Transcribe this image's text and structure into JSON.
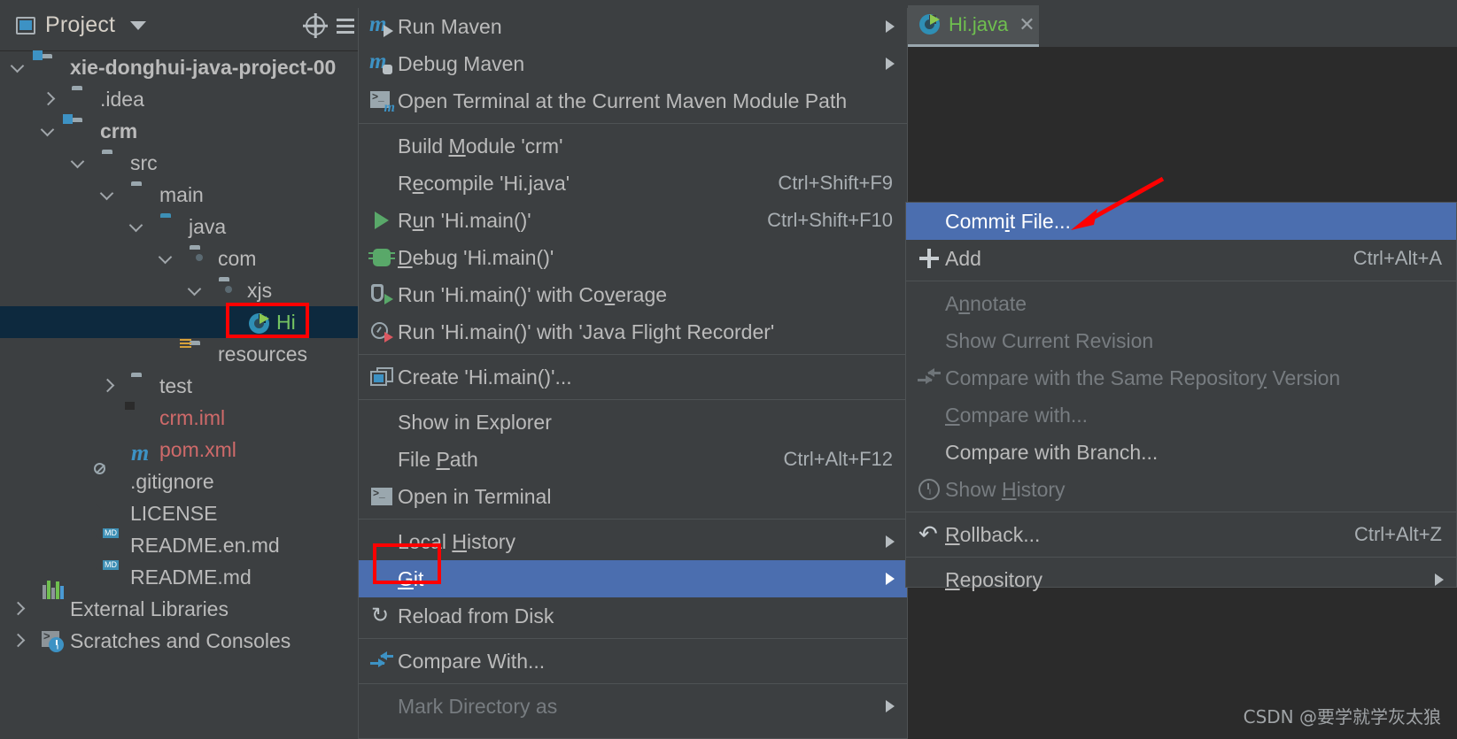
{
  "colors": {
    "panel_bg": "#3c3f41",
    "editor_bg": "#2b2b2b",
    "menu_highlight": "#4b6eaf",
    "tree_selection": "#0d293e",
    "annotation_red": "#ff0000",
    "accent_blue": "#3d92c4",
    "run_green": "#59a869"
  },
  "project_panel": {
    "title": "Project",
    "title_icon": "project-window-icon",
    "dropdown_icon": "chevron-down-icon",
    "toolbar_icons": [
      "locate-icon",
      "collapse-all-icon"
    ],
    "tree": [
      {
        "label": "xie-donghui-java-project-00",
        "indent": 14,
        "arrow": "open",
        "icon": "module-folder-icon",
        "style": "bold"
      },
      {
        "label": ".idea",
        "indent": 48,
        "arrow": "closed",
        "icon": "folder-icon",
        "style": "plain"
      },
      {
        "label": "crm",
        "indent": 48,
        "arrow": "open",
        "icon": "module-folder-icon",
        "style": "bold"
      },
      {
        "label": "src",
        "indent": 82,
        "arrow": "open",
        "icon": "folder-icon",
        "style": "plain"
      },
      {
        "label": "main",
        "indent": 115,
        "arrow": "open",
        "icon": "folder-icon",
        "style": "plain"
      },
      {
        "label": "java",
        "indent": 148,
        "arrow": "open",
        "icon": "source-folder-icon",
        "style": "plain"
      },
      {
        "label": "com",
        "indent": 181,
        "arrow": "open",
        "icon": "package-folder-icon",
        "style": "plain"
      },
      {
        "label": "xjs",
        "indent": 214,
        "arrow": "open",
        "icon": "package-folder-icon",
        "style": "plain"
      },
      {
        "label": "Hi",
        "indent": 247,
        "arrow": "none",
        "icon": "java-class-run-icon",
        "style": "green",
        "selected": true
      },
      {
        "label": "resources",
        "indent": 181,
        "arrow": "none",
        "icon": "resources-folder-icon",
        "style": "plain"
      },
      {
        "label": "test",
        "indent": 115,
        "arrow": "closed",
        "icon": "folder-icon",
        "style": "plain"
      },
      {
        "label": "crm.iml",
        "indent": 115,
        "arrow": "none",
        "icon": "iml-file-icon",
        "style": "red"
      },
      {
        "label": "pom.xml",
        "indent": 115,
        "arrow": "none",
        "icon": "maven-pom-icon",
        "style": "red"
      },
      {
        "label": ".gitignore",
        "indent": 82,
        "arrow": "none",
        "icon": "gitignore-file-icon",
        "style": "plain"
      },
      {
        "label": "LICENSE",
        "indent": 82,
        "arrow": "none",
        "icon": "text-file-icon",
        "style": "plain"
      },
      {
        "label": "README.en.md",
        "indent": 82,
        "arrow": "none",
        "icon": "markdown-file-icon",
        "style": "plain"
      },
      {
        "label": "README.md",
        "indent": 82,
        "arrow": "none",
        "icon": "markdown-file-icon",
        "style": "plain"
      },
      {
        "label": "External Libraries",
        "indent": 14,
        "arrow": "closed",
        "icon": "libraries-icon",
        "style": "plain"
      },
      {
        "label": "Scratches and Consoles",
        "indent": 14,
        "arrow": "closed",
        "icon": "scratches-icon",
        "style": "plain"
      }
    ]
  },
  "context_menu": {
    "items": [
      {
        "label": "Run Maven",
        "icon": "maven-run-icon",
        "shortcut": "",
        "submenu": true,
        "mnemonic": ""
      },
      {
        "label": "Debug Maven",
        "icon": "maven-debug-icon",
        "shortcut": "",
        "submenu": true,
        "mnemonic": ""
      },
      {
        "label": "Open Terminal at the Current Maven Module Path",
        "icon": "terminal-maven-icon",
        "shortcut": "",
        "submenu": false,
        "mnemonic": ""
      },
      {
        "separator": true
      },
      {
        "label": "Build Module 'crm'",
        "icon": "",
        "shortcut": "",
        "submenu": false,
        "mnemonic": "M"
      },
      {
        "label": "Recompile 'Hi.java'",
        "icon": "",
        "shortcut": "Ctrl+Shift+F9",
        "submenu": false,
        "mnemonic": "e"
      },
      {
        "label": "Run 'Hi.main()'",
        "icon": "run-icon",
        "shortcut": "Ctrl+Shift+F10",
        "submenu": false,
        "mnemonic": "u"
      },
      {
        "label": "Debug 'Hi.main()'",
        "icon": "debug-icon",
        "shortcut": "",
        "submenu": false,
        "mnemonic": "D"
      },
      {
        "label": "Run 'Hi.main()' with Coverage",
        "icon": "coverage-icon",
        "shortcut": "",
        "submenu": false,
        "mnemonic": "v"
      },
      {
        "label": "Run 'Hi.main()' with 'Java Flight Recorder'",
        "icon": "flight-recorder-icon",
        "shortcut": "",
        "submenu": false,
        "mnemonic": ""
      },
      {
        "separator": true
      },
      {
        "label": "Create 'Hi.main()'...",
        "icon": "create-config-icon",
        "shortcut": "",
        "submenu": false,
        "mnemonic": ""
      },
      {
        "separator": true
      },
      {
        "label": "Show in Explorer",
        "icon": "",
        "shortcut": "",
        "submenu": false,
        "mnemonic": ""
      },
      {
        "label": "File Path",
        "icon": "",
        "shortcut": "Ctrl+Alt+F12",
        "submenu": false,
        "mnemonic": "P"
      },
      {
        "label": "Open in Terminal",
        "icon": "terminal-icon",
        "shortcut": "",
        "submenu": false,
        "mnemonic": ""
      },
      {
        "separator": true
      },
      {
        "label": "Local History",
        "icon": "",
        "shortcut": "",
        "submenu": true,
        "mnemonic": "H"
      },
      {
        "label": "Git",
        "icon": "",
        "shortcut": "",
        "submenu": true,
        "mnemonic": "G",
        "highlighted": true
      },
      {
        "label": "Reload from Disk",
        "icon": "reload-icon",
        "shortcut": "",
        "submenu": false,
        "mnemonic": ""
      },
      {
        "separator": true
      },
      {
        "label": "Compare With...",
        "icon": "compare-icon",
        "shortcut": "",
        "submenu": false,
        "mnemonic": ""
      },
      {
        "separator": true
      },
      {
        "label": "Mark Directory as",
        "icon": "",
        "shortcut": "",
        "submenu": true,
        "mnemonic": "",
        "disabled": true
      }
    ]
  },
  "git_submenu": {
    "items": [
      {
        "label": "Commit File...",
        "icon": "",
        "shortcut": "",
        "submenu": false,
        "mnemonic": "i",
        "highlighted": true
      },
      {
        "label": "Add",
        "icon": "add-icon",
        "shortcut": "Ctrl+Alt+A",
        "submenu": false,
        "mnemonic": ""
      },
      {
        "separator": true
      },
      {
        "label": "Annotate",
        "icon": "",
        "shortcut": "",
        "submenu": false,
        "mnemonic": "n",
        "disabled": true
      },
      {
        "label": "Show Current Revision",
        "icon": "",
        "shortcut": "",
        "submenu": false,
        "mnemonic": "",
        "disabled": true
      },
      {
        "label": "Compare with the Same Repository Version",
        "icon": "compare-icon-gray",
        "shortcut": "",
        "submenu": false,
        "mnemonic": "y",
        "disabled": true
      },
      {
        "label": "Compare with...",
        "icon": "",
        "shortcut": "",
        "submenu": false,
        "mnemonic": "C",
        "disabled": true
      },
      {
        "label": "Compare with Branch...",
        "icon": "",
        "shortcut": "",
        "submenu": false,
        "mnemonic": ""
      },
      {
        "label": "Show History",
        "icon": "history-icon",
        "shortcut": "",
        "submenu": false,
        "mnemonic": "H",
        "disabled": true
      },
      {
        "separator": true
      },
      {
        "label": "Rollback...",
        "icon": "rollback-icon",
        "shortcut": "Ctrl+Alt+Z",
        "submenu": false,
        "mnemonic": "R"
      },
      {
        "separator": true
      },
      {
        "label": "Repository",
        "icon": "",
        "shortcut": "",
        "submenu": true,
        "mnemonic": "R"
      }
    ]
  },
  "editor": {
    "tab": {
      "label": "Hi.java",
      "icon": "java-class-run-icon",
      "close_icon": "close-icon"
    }
  },
  "annotations": {
    "boxes": [
      "hi-class-highlight-box",
      "git-menu-highlight-box"
    ],
    "arrow": "commit-file-pointer-arrow"
  },
  "watermark": "CSDN @要学就学灰太狼"
}
